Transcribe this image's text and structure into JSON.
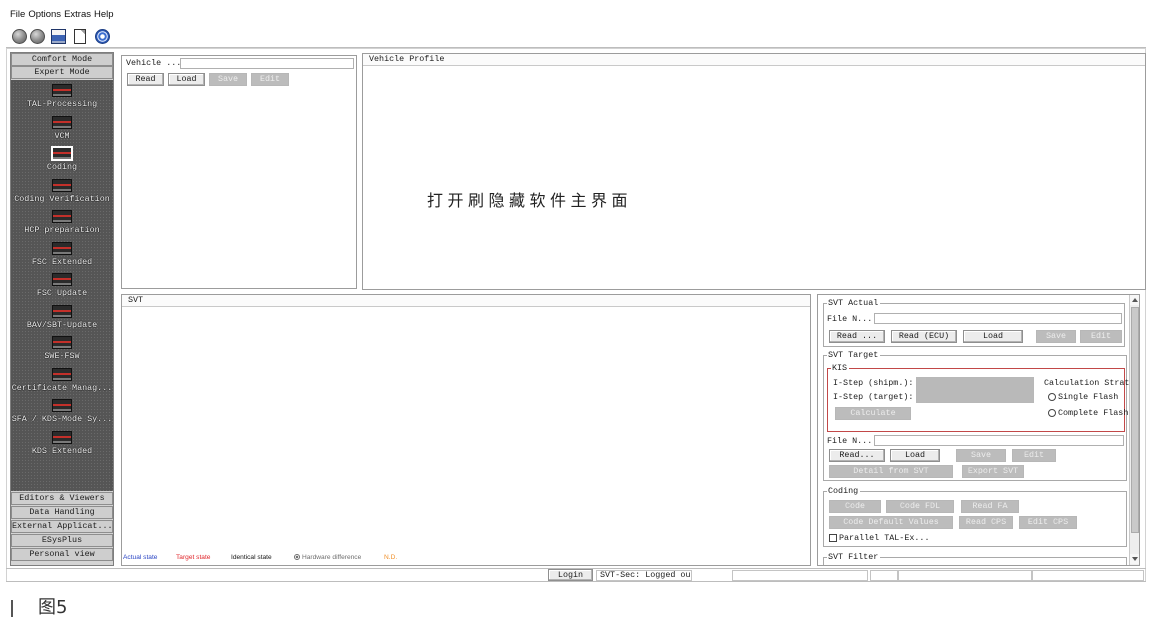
{
  "menu": {
    "items": [
      "File",
      "Options",
      "Extras",
      "Help"
    ]
  },
  "toolbar": {
    "icons": [
      "connect-icon",
      "disconnect-icon",
      "save-session-icon",
      "new-document-icon",
      "help-icon"
    ]
  },
  "sidebar": {
    "top_buttons": [
      "Comfort Mode",
      "Expert Mode"
    ],
    "expert_items": [
      {
        "label": "TAL-Processing",
        "selected": false
      },
      {
        "label": "VCM",
        "selected": false
      },
      {
        "label": "Coding",
        "selected": true
      },
      {
        "label": "Coding Verification",
        "selected": false
      },
      {
        "label": "HCP preparation",
        "selected": false
      },
      {
        "label": "FSC Extended",
        "selected": false
      },
      {
        "label": "FSC Update",
        "selected": false
      },
      {
        "label": "BAV/SBT-Update",
        "selected": false
      },
      {
        "label": "SWE-FSW",
        "selected": false
      },
      {
        "label": "Certificate Manag...",
        "selected": false
      },
      {
        "label": "SFA / KDS-Mode Sy...",
        "selected": false
      },
      {
        "label": "KDS Extended",
        "selected": false
      }
    ],
    "bottom_buttons": [
      "Editors & Viewers",
      "Data Handling",
      "External Applicat...",
      "ESysPlus",
      "Personal view"
    ]
  },
  "vehicle": {
    "label": "Vehicle ...",
    "value": "",
    "buttons": [
      {
        "label": "Read",
        "enabled": true
      },
      {
        "label": "Load",
        "enabled": true
      },
      {
        "label": "Save",
        "enabled": false
      },
      {
        "label": "Edit",
        "enabled": false
      }
    ]
  },
  "vehicle_profile": {
    "title": "Vehicle Profile",
    "annotation": "打开刷隐藏软件主界面"
  },
  "svt": {
    "title": "SVT",
    "legend": [
      {
        "label": "Actual state",
        "color": "#2a45c4"
      },
      {
        "label": "Target state",
        "color": "#e0262b"
      },
      {
        "label": "Identical state",
        "color": "#141414"
      },
      {
        "label": "Hardware difference",
        "color": "#6e6e6e"
      },
      {
        "label": "N.D.",
        "color": "#f0902a"
      }
    ]
  },
  "svt_actual": {
    "title": "SVT Actual",
    "file_label": "File N...",
    "file_value": "",
    "buttons": [
      {
        "label": "Read ...",
        "enabled": true
      },
      {
        "label": "Read (ECU)",
        "enabled": true
      },
      {
        "label": "Load",
        "enabled": true
      },
      {
        "label": "Save",
        "enabled": false
      },
      {
        "label": "Edit",
        "enabled": false
      }
    ]
  },
  "svt_target": {
    "title": "SVT Target",
    "kis": {
      "title": "KIS",
      "istep_shipm_label": "I-Step (shipm.):",
      "istep_target_label": "I-Step (target):",
      "istep_value": "",
      "calculate_button": {
        "label": "Calculate",
        "enabled": false
      },
      "strategy_label": "Calculation Strate",
      "strategy_options": [
        {
          "label": "Single Flash",
          "checked": false
        },
        {
          "label": "Complete Flash",
          "checked": false
        }
      ]
    },
    "file_label": "File N...",
    "file_value": "",
    "buttons": [
      {
        "label": "Read...",
        "enabled": true
      },
      {
        "label": "Load",
        "enabled": true
      },
      {
        "label": "Save",
        "enabled": false
      },
      {
        "label": "Edit",
        "enabled": false
      }
    ],
    "extra_buttons": [
      {
        "label": "Detail from SVT",
        "enabled": false
      },
      {
        "label": "Export SVT",
        "enabled": false
      }
    ]
  },
  "coding": {
    "title": "Coding",
    "buttons": [
      {
        "label": "Code",
        "enabled": false
      },
      {
        "label": "Code FDL",
        "enabled": false
      },
      {
        "label": "Read FA",
        "enabled": false
      },
      {
        "label": "Code Default Values",
        "enabled": false
      },
      {
        "label": "Read CPS",
        "enabled": false
      },
      {
        "label": "Edit CPS",
        "enabled": false
      }
    ],
    "parallel_label": "Parallel TAL-Ex...",
    "parallel_checked": false
  },
  "svt_filter": {
    "title": "SVT Filter"
  },
  "statusbar": {
    "login_label": "Login",
    "svt_sec": "SVT-Sec: Logged out"
  },
  "caption": "图5"
}
